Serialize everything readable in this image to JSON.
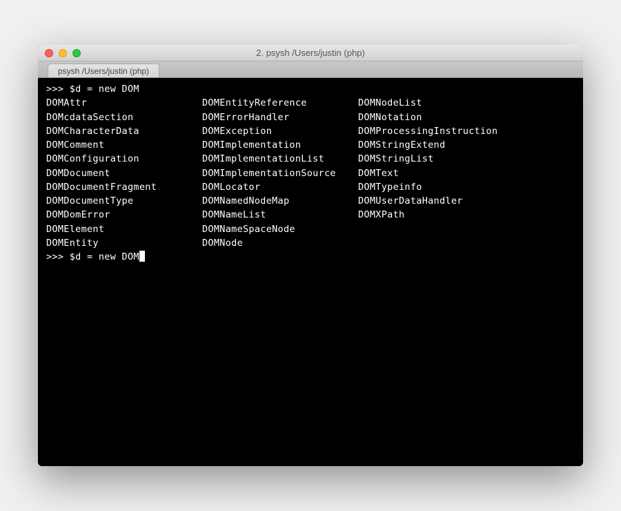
{
  "window": {
    "title": "2. psysh  /Users/justin (php)"
  },
  "tab": {
    "label": "psysh  /Users/justin (php)"
  },
  "terminal": {
    "prompt1": ">>> $d = new DOM",
    "prompt2": ">>> $d = new DOM",
    "columns": [
      [
        "DOMAttr",
        "DOMcdataSection",
        "DOMCharacterData",
        "DOMComment",
        "DOMConfiguration",
        "DOMDocument",
        "DOMDocumentFragment",
        "DOMDocumentType",
        "DOMDomError",
        "DOMElement",
        "DOMEntity"
      ],
      [
        "DOMEntityReference",
        "DOMErrorHandler",
        "DOMException",
        "DOMImplementation",
        "DOMImplementationList",
        "DOMImplementationSource",
        "DOMLocator",
        "DOMNamedNodeMap",
        "DOMNameList",
        "DOMNameSpaceNode",
        "DOMNode"
      ],
      [
        "DOMNodeList",
        "DOMNotation",
        "DOMProcessingInstruction",
        "DOMStringExtend",
        "DOMStringList",
        "DOMText",
        "DOMTypeinfo",
        "DOMUserDataHandler",
        "DOMXPath"
      ]
    ]
  }
}
